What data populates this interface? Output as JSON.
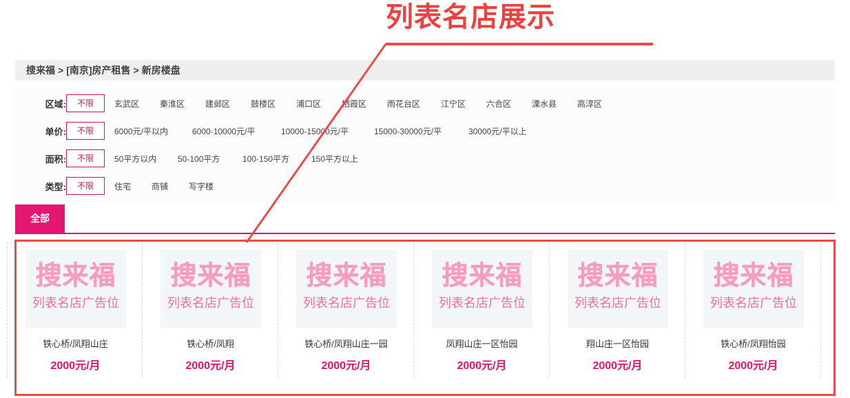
{
  "annotation": {
    "title": "列表名店展示"
  },
  "breadcrumb": {
    "items": [
      "搜来福",
      "[南京]房产租售",
      "新房楼盘"
    ],
    "separator": ">"
  },
  "filters": {
    "nolimit": "不限",
    "rows": [
      {
        "label": "区域:",
        "options": [
          "玄武区",
          "秦淮区",
          "建邺区",
          "鼓楼区",
          "浦口区",
          "栖霞区",
          "雨花台区",
          "江宁区",
          "六合区",
          "溧水县",
          "高淳区"
        ]
      },
      {
        "label": "单价:",
        "options": [
          "6000元/平以内",
          "6000-10000元/平",
          "10000-15000元/平",
          "15000-30000元/平",
          "30000元/平以上"
        ]
      },
      {
        "label": "面积:",
        "options": [
          "50平方以内",
          "50-100平方",
          "100-150平方",
          "150平方以上"
        ]
      },
      {
        "label": "类型:",
        "options": [
          "住宅",
          "商铺",
          "写字楼"
        ]
      }
    ]
  },
  "tabs": {
    "all": "全部"
  },
  "listings": [
    {
      "ad_line1": "搜来福",
      "ad_line2": "列表名店广告位",
      "name": "铁心桥/凤翔山庄",
      "price": "2000元/月"
    },
    {
      "ad_line1": "搜来福",
      "ad_line2": "列表名店广告位",
      "name": "铁心桥/凤翔",
      "price": "2000元/月"
    },
    {
      "ad_line1": "搜来福",
      "ad_line2": "列表名店广告位",
      "name": "铁心桥/凤翔山庄一园",
      "price": "2000元/月"
    },
    {
      "ad_line1": "搜来福",
      "ad_line2": "列表名店广告位",
      "name": "凤翔山庄一区怡园",
      "price": "2000元/月"
    },
    {
      "ad_line1": "搜来福",
      "ad_line2": "列表名店广告位",
      "name": "翔山庄一区怡园",
      "price": "2000元/月"
    },
    {
      "ad_line1": "搜来福",
      "ad_line2": "列表名店广告位",
      "name": "铁心桥/凤翔怡园",
      "price": "2000元/月"
    }
  ],
  "colors": {
    "accent": "#e6156f",
    "annotation": "#ef4040",
    "tab_underline": "#c31a86"
  }
}
